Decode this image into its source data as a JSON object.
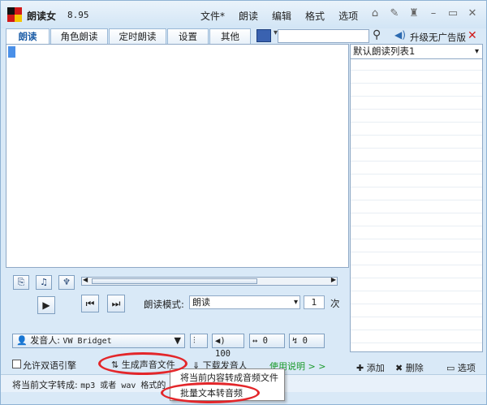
{
  "titlebar": {
    "app_name": "朗读女",
    "version": "8.95",
    "menus": [
      "文件*",
      "朗读",
      "编辑",
      "格式",
      "选项"
    ],
    "icons": [
      "home-icon",
      "tool-icon",
      "shirt-icon",
      "minimize-icon",
      "maximize-icon",
      "close-icon"
    ]
  },
  "tabs": [
    "朗读",
    "角色朗读",
    "定时朗读",
    "设置",
    "其他"
  ],
  "active_tab": "朗读",
  "search": {
    "value": ""
  },
  "upgrade_label": "升级无广告版",
  "list": {
    "selected": "默认朗读列表1"
  },
  "playback": {
    "mode_label": "朗读模式:",
    "mode_value": "朗读",
    "count_value": "1",
    "count_unit": "次"
  },
  "voice": {
    "label": "发音人:",
    "value": "VW Bridget",
    "volume": "100",
    "speed": "0",
    "pitch": "0"
  },
  "actions": {
    "bilingual": "允许双语引擎",
    "generate": "生成声音文件",
    "download": "下载发音人",
    "help": "使用说明 > >"
  },
  "list_actions": {
    "add": "添加",
    "delete": "删除",
    "options": "选项"
  },
  "status": {
    "prefix": "将当前文字转成:",
    "formats": "mp3 或者 wav 格式",
    "suffix": "的"
  },
  "popup": {
    "item1": "将当前内容转成音频文件",
    "item2": "批量文本转音频"
  },
  "colors": {
    "accent": "#1f5fa8",
    "highlight_ring": "#e3262a",
    "help_link": "#1a9a2a"
  }
}
